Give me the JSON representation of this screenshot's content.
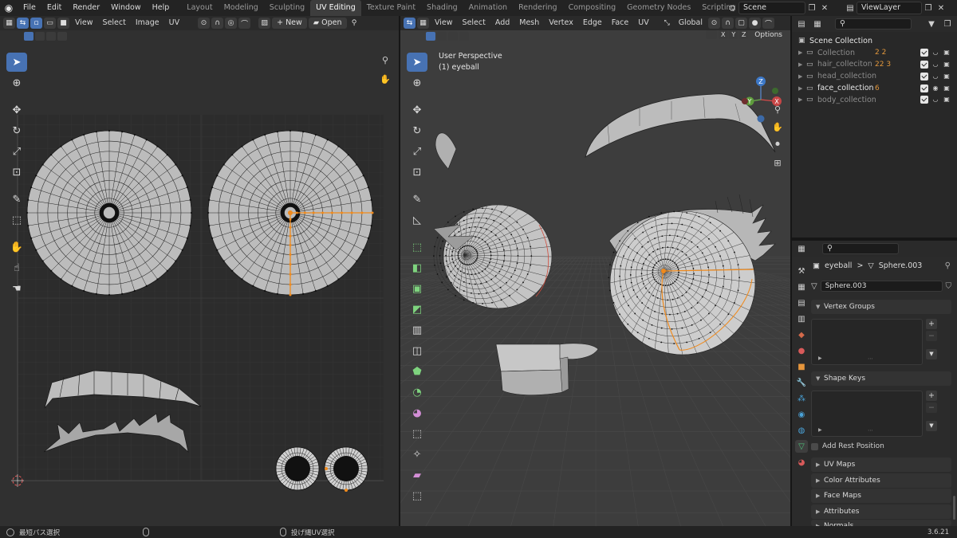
{
  "menu": [
    "File",
    "Edit",
    "Render",
    "Window",
    "Help"
  ],
  "workspaces": [
    {
      "label": "Layout",
      "active": false
    },
    {
      "label": "Modeling",
      "active": false
    },
    {
      "label": "Sculpting",
      "active": false
    },
    {
      "label": "UV Editing",
      "active": true
    },
    {
      "label": "Texture Paint",
      "active": false
    },
    {
      "label": "Shading",
      "active": false
    },
    {
      "label": "Animation",
      "active": false
    },
    {
      "label": "Rendering",
      "active": false
    },
    {
      "label": "Compositing",
      "active": false
    },
    {
      "label": "Geometry Nodes",
      "active": false
    },
    {
      "label": "Scripting",
      "active": false
    }
  ],
  "workspace_add": "+",
  "scene": {
    "name": "Scene"
  },
  "view_layer": {
    "name": "ViewLayer"
  },
  "uv_editor": {
    "menus": [
      "View",
      "Select",
      "Image",
      "UV"
    ],
    "new_label": "New",
    "open_label": "Open"
  },
  "viewport": {
    "menus": [
      "View",
      "Select",
      "Add",
      "Mesh",
      "Vertex",
      "Edge",
      "Face",
      "UV"
    ],
    "orientation": "Global",
    "axes": [
      "X",
      "Y",
      "Z"
    ],
    "options_label": "Options",
    "info_line1": "User Perspective",
    "info_line2": "(1) eyeball",
    "gizmo": {
      "x": "X",
      "y": "Y",
      "z": "Z"
    }
  },
  "outliner": {
    "root": "Scene Collection",
    "rows": [
      {
        "label": "Collection",
        "extra": "2  2",
        "dim": true,
        "hi": false
      },
      {
        "label": "hair_colleciton",
        "extra": "22  3",
        "dim": true,
        "hi": false
      },
      {
        "label": "head_collection",
        "extra": "",
        "dim": true,
        "hi": false
      },
      {
        "label": "face_collection",
        "extra": "6",
        "dim": false,
        "hi": true
      },
      {
        "label": "body_collection",
        "extra": "",
        "dim": true,
        "hi": false
      }
    ]
  },
  "properties": {
    "breadcrumb_object": "eyeball",
    "breadcrumb_sep": ">",
    "breadcrumb_mesh": "Sphere.003",
    "mesh_name": "Sphere.003",
    "panels": {
      "vertex_groups": "Vertex Groups",
      "shape_keys": "Shape Keys",
      "add_rest_position": "Add Rest Position",
      "uv_maps": "UV Maps",
      "color_attributes": "Color Attributes",
      "face_maps": "Face Maps",
      "attributes": "Attributes",
      "normals": "Normals"
    },
    "list_plus": "+",
    "list_minus": "−"
  },
  "status": {
    "left_hint": "最短パス選択",
    "mid_hint": "投げ縄UV選択",
    "version": "3.6.21"
  },
  "colors": {
    "accent": "#4772b3",
    "selection": "#f08a1c",
    "uv_bg": "#303030",
    "viewport_bg": "#3d3d3d"
  }
}
